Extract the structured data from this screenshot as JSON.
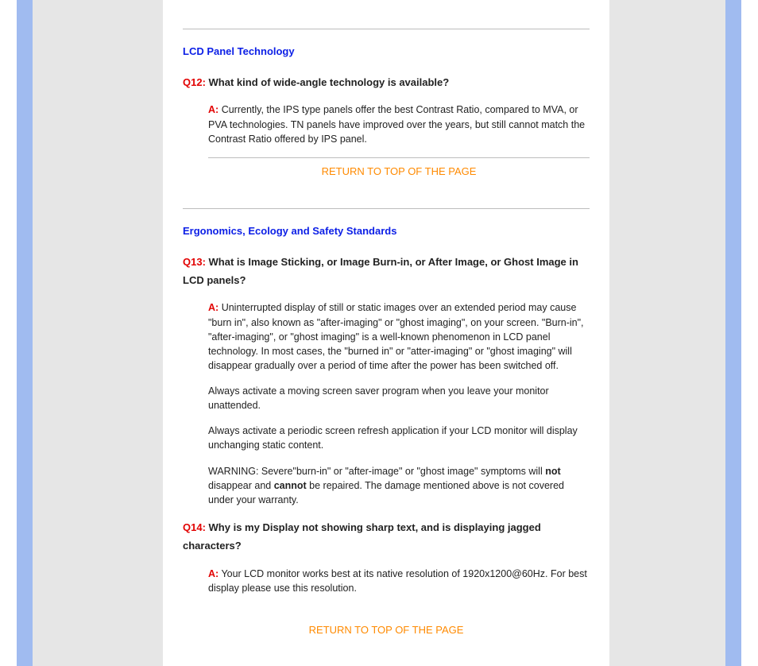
{
  "sections": [
    {
      "heading": "LCD Panel Technology",
      "qa": [
        {
          "q_label": "Q12:",
          "q_text": "What kind of wide-angle technology is available?",
          "a_label": "A:",
          "a_paragraphs": [
            "Currently, the IPS type panels offer the best Contrast Ratio, compared to MVA, or PVA technologies.  TN panels have improved over the years, but still cannot match the Contrast Ratio offered by IPS panel."
          ],
          "return_link": "RETURN TO TOP OF THE PAGE"
        }
      ]
    },
    {
      "heading": "Ergonomics, Ecology and Safety Standards",
      "qa": [
        {
          "q_label": "Q13:",
          "q_text": "What is Image Sticking, or Image Burn-in, or After Image, or Ghost Image in LCD panels?",
          "a_label": "A:",
          "a_paragraphs": [
            "Uninterrupted display of still or static images over an extended period may cause \"burn in\", also known as \"after-imaging\" or \"ghost imaging\", on your screen. \"Burn-in\", \"after-imaging\", or \"ghost imaging\" is a well-known phenomenon in LCD panel technology. In most cases, the \"burned in\" or \"atter-imaging\" or \"ghost imaging\" will disappear gradually over a period of time after the power has been switched off.",
            "Always activate a moving screen saver program when you leave your monitor unattended.",
            "Always activate a periodic screen refresh application if your LCD monitor will display unchanging static content."
          ],
          "warn_pre": "WARNING: Severe\"burn-in\" or \"after-image\" or \"ghost image\" symptoms will ",
          "warn_bold1": "not",
          "warn_mid": " disappear and ",
          "warn_bold2": "cannot",
          "warn_post": " be repaired. The damage mentioned above is not covered under your warranty."
        },
        {
          "q_label": "Q14:",
          "q_text": "Why is my Display not showing sharp text, and is displaying jagged characters?",
          "a_label": "A:",
          "a_paragraphs": [
            "Your LCD monitor works best at its native resolution of 1920x1200@60Hz. For best display please use this resolution."
          ]
        }
      ],
      "return_link": "RETURN TO TOP OF THE PAGE"
    }
  ]
}
